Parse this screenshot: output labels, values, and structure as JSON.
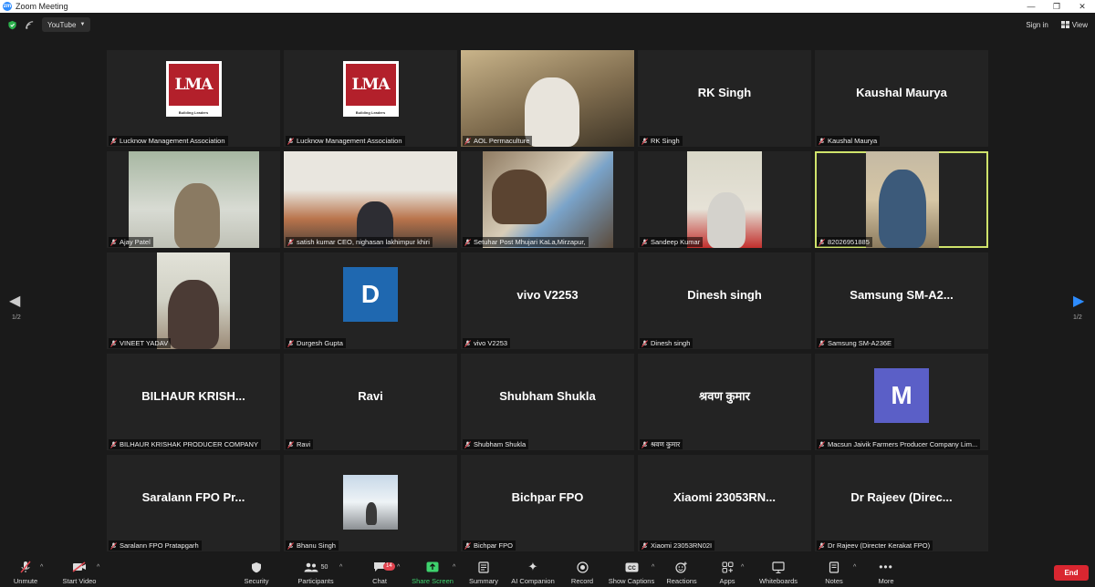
{
  "window": {
    "title": "Zoom Meeting",
    "controls": [
      "—",
      "❐",
      "✕"
    ]
  },
  "topbar": {
    "youtube_label": "YouTube",
    "signin_label": "Sign in",
    "view_label": "View"
  },
  "nav": {
    "left_page": "1/2",
    "right_page": "1/2"
  },
  "tiles": [
    {
      "type": "logo",
      "label": "Lucknow Management Association",
      "logo_text": "LMA",
      "logo_tagline": "Building Leaders"
    },
    {
      "type": "logo",
      "label": "Lucknow Management Association",
      "logo_text": "LMA",
      "logo_tagline": "Building Leaders"
    },
    {
      "type": "video",
      "label": "AOL Permaculture"
    },
    {
      "type": "name",
      "label": "RK Singh",
      "display": "RK Singh"
    },
    {
      "type": "name",
      "label": "Kaushal Maurya",
      "display": "Kaushal Maurya"
    },
    {
      "type": "video",
      "label": "Ajay Patel"
    },
    {
      "type": "video",
      "label": "satish kumar CEO, nighasan lakhimpur khiri"
    },
    {
      "type": "video",
      "label": "Setuhar Post Mhujari KaLa,Mirzapur,"
    },
    {
      "type": "video",
      "label": "Sandeep Kumar"
    },
    {
      "type": "video",
      "label": "82026951885",
      "active": true
    },
    {
      "type": "video",
      "label": "VINEET YADAV"
    },
    {
      "type": "avatar",
      "label": "Durgesh Gupta",
      "initial": "D",
      "color": "#1f68b0"
    },
    {
      "type": "name",
      "label": "vivo V2253",
      "display": "vivo V2253"
    },
    {
      "type": "name",
      "label": "Dinesh singh",
      "display": "Dinesh singh"
    },
    {
      "type": "name",
      "label": "Samsung SM-A236E",
      "display": "Samsung  SM-A2..."
    },
    {
      "type": "name",
      "label": "BILHAUR KRISHAK PRODUCER COMPANY",
      "display": "BILHAUR  KRISH..."
    },
    {
      "type": "name",
      "label": "Ravi",
      "display": "Ravi"
    },
    {
      "type": "name",
      "label": "Shubham Shukla",
      "display": "Shubham Shukla"
    },
    {
      "type": "name",
      "label": "श्रवण कुमार",
      "display": "श्रवण कुमार"
    },
    {
      "type": "avatar",
      "label": "Macsun Jaivik Farmers Producer Company Lim...",
      "initial": "M",
      "color": "#5b5fc7"
    },
    {
      "type": "name",
      "label": "Saralann FPO Pratapgarh",
      "display": "Saralann FPO  Pr..."
    },
    {
      "type": "video",
      "label": "Bhanu Singh"
    },
    {
      "type": "name",
      "label": "Bichpar FPO",
      "display": "Bichpar FPO"
    },
    {
      "type": "name",
      "label": "Xiaomi 23053RN02I",
      "display": "Xiaomi  23053RN..."
    },
    {
      "type": "name",
      "label": "Dr Rajeev (Directer Kerakat FPO)",
      "display": "Dr Rajeev  (Direc..."
    }
  ],
  "toolbar": {
    "unmute": "Unmute",
    "start_video": "Start Video",
    "security": "Security",
    "participants": "Participants",
    "participants_count": "50",
    "chat": "Chat",
    "chat_badge": "14",
    "share_screen": "Share Screen",
    "summary": "Summary",
    "ai_companion": "AI Companion",
    "record": "Record",
    "show_captions": "Show Captions",
    "reactions": "Reactions",
    "apps": "Apps",
    "whiteboards": "Whiteboards",
    "notes": "Notes",
    "more": "More",
    "end": "End"
  },
  "colors": {
    "active_border": "#cfe36b",
    "share_green": "#3ed26d",
    "end_red": "#d92630",
    "nav_blue": "#2d8cff"
  }
}
